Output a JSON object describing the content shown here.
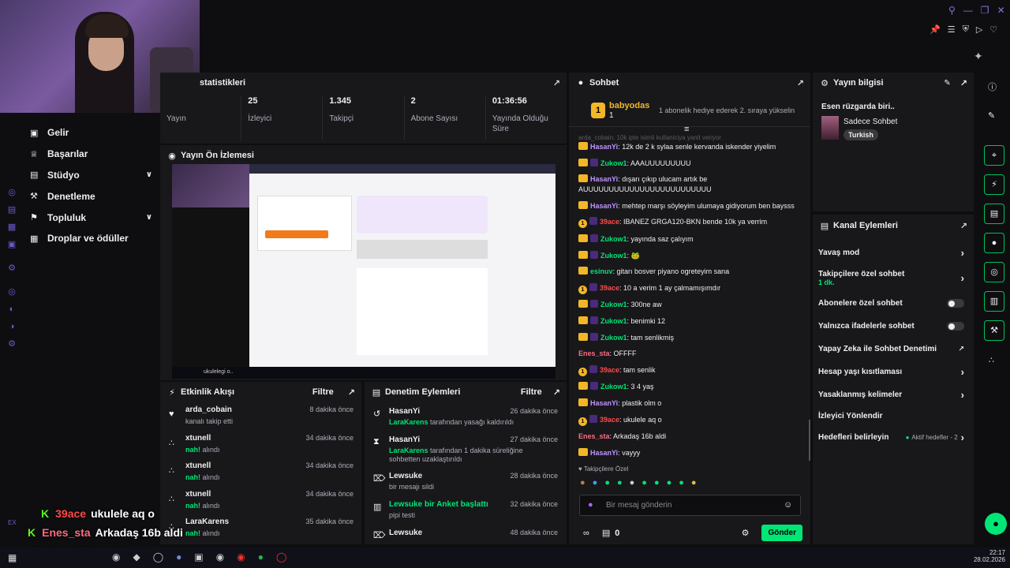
{
  "topbar": {
    "icons": [
      "search-icon",
      "minimize-icon",
      "maximize-icon",
      "close-icon"
    ],
    "toolbar_icons": [
      "pin-icon",
      "list-icon",
      "shield-icon",
      "play-icon",
      "heart-icon"
    ]
  },
  "sidebar": {
    "items": [
      {
        "label": "Gelir",
        "icon": "money-icon",
        "expand": false
      },
      {
        "label": "Başarılar",
        "icon": "trophy-icon",
        "expand": false
      },
      {
        "label": "Stüdyo",
        "icon": "studio-icon",
        "expand": true
      },
      {
        "label": "Denetleme",
        "icon": "hammer-icon",
        "expand": false
      },
      {
        "label": "Topluluk",
        "icon": "community-icon",
        "expand": true
      },
      {
        "label": "Droplar ve ödüller",
        "icon": "drops-icon",
        "expand": false
      }
    ]
  },
  "stats": {
    "title": "statistikleri",
    "items": [
      {
        "value": "",
        "label": "Yayın"
      },
      {
        "value": "25",
        "label": "İzleyici"
      },
      {
        "value": "1.345",
        "label": "Takipçi"
      },
      {
        "value": "2",
        "label": "Abone Sayısı"
      },
      {
        "value": "01:36:56",
        "label": "Yayında Olduğu Süre"
      }
    ]
  },
  "preview": {
    "title": "Yayın Ön İzlemesi",
    "taskbar_text": "ukulelegi o.."
  },
  "activity": {
    "title": "Etkinlik Akışı",
    "filter": "Filtre",
    "items": [
      {
        "user": "arda_cobain",
        "time": "8 dakika önce",
        "pre": "",
        "hl": "",
        "post": "kanalı takip etti"
      },
      {
        "user": "xtunell",
        "time": "34 dakika önce",
        "pre": "",
        "hl": "nah!",
        "post": " alındı"
      },
      {
        "user": "xtunell",
        "time": "34 dakika önce",
        "pre": "",
        "hl": "nah!",
        "post": " alındı"
      },
      {
        "user": "xtunell",
        "time": "34 dakika önce",
        "pre": "",
        "hl": "nah!",
        "post": " alındı"
      },
      {
        "user": "LaraKarens",
        "time": "35 dakika önce",
        "pre": "",
        "hl": "nah!",
        "post": " alındı"
      }
    ]
  },
  "modactions": {
    "title": "Denetim Eylemleri",
    "filter": "Filtre",
    "items": [
      {
        "user": "HasanYi",
        "time": "26 dakika önce",
        "hl": "LaraKarens",
        "text": " tarafından yasağı kaldırıldı"
      },
      {
        "user": "HasanYi",
        "time": "27 dakika önce",
        "hl": "LaraKarens",
        "text": " tarafından 1 dakika süreliğine sohbetten uzaklaştırıldı"
      },
      {
        "user": "Lewsuke",
        "time": "28 dakika önce",
        "hl": "",
        "text": "bir mesajı sildi"
      },
      {
        "user": "Lewsuke bir Anket başlattı",
        "time": "32 dakika önce",
        "hl": "",
        "text": "pipi testi"
      },
      {
        "user": "Lewsuke",
        "time": "48 dakika önce",
        "hl": "",
        "text": ""
      }
    ]
  },
  "chat": {
    "title": "Sohbet",
    "pinned_user": "babyodas",
    "pinned_count": "1",
    "pinned_msg": "1 abonelik hediye ederek 2. sıraya yükselin",
    "faded": "arda_cobain: 10k ipte isimli kullaniciya yanit veriyor",
    "messages": [
      {
        "badge": "crown",
        "gift": false,
        "user": "HasanYi",
        "color": "#bf94ff",
        "text": "12k de 2 k sylaa senle kervanda iskender yiyelim"
      },
      {
        "badge": "crown",
        "gift": true,
        "user": "Zukow1",
        "color": "#00e676",
        "text": "AAAUUUUUUUUU"
      },
      {
        "badge": "crown",
        "gift": false,
        "user": "HasanYi",
        "color": "#bf94ff",
        "text": "dışarı çıkıp ulucam artık be AUUUUUUUUUUUUUUUUUUUUUUUUU"
      },
      {
        "badge": "crown",
        "gift": false,
        "user": "HasanYi",
        "color": "#bf94ff",
        "text": "mehtep marşı söyleyim ulumaya gidiyorum ben baysss"
      },
      {
        "badge": "sub",
        "gift": true,
        "user": "39ace",
        "color": "#ff4a4a",
        "text": "IBANEZ GRGA120-BKN bende 10k ya verrim"
      },
      {
        "badge": "crown",
        "gift": true,
        "user": "Zukow1",
        "color": "#00e676",
        "text": "yayında saz çalıyım"
      },
      {
        "badge": "crown",
        "gift": true,
        "user": "Zukow1",
        "color": "#00e676",
        "text": "🐸"
      },
      {
        "badge": "crown",
        "gift": false,
        "user": "esinuv",
        "color": "#00e676",
        "text": "gitarı bosver piyano ogreteyim sana"
      },
      {
        "badge": "sub",
        "gift": true,
        "user": "39ace",
        "color": "#ff4a4a",
        "text": "10 a verim 1 ay çalmamışımdır"
      },
      {
        "badge": "crown",
        "gift": true,
        "user": "Zukow1",
        "color": "#00e676",
        "text": "300ne aw"
      },
      {
        "badge": "crown",
        "gift": true,
        "user": "Zukow1",
        "color": "#00e676",
        "text": "benimki 12"
      },
      {
        "badge": "crown",
        "gift": true,
        "user": "Zukow1",
        "color": "#00e676",
        "text": "tam senlikmiş"
      },
      {
        "badge": "",
        "gift": false,
        "user": "Enes_sta",
        "color": "#ff6b81",
        "text": "OFFFF"
      },
      {
        "badge": "sub",
        "gift": true,
        "user": "39ace",
        "color": "#ff4a4a",
        "text": "tam senlik"
      },
      {
        "badge": "crown",
        "gift": true,
        "user": "Zukow1",
        "color": "#00e676",
        "text": "3 4 yaş"
      },
      {
        "badge": "crown",
        "gift": false,
        "user": "HasanYi",
        "color": "#bf94ff",
        "text": "plastik olm o"
      },
      {
        "badge": "sub",
        "gift": true,
        "user": "39ace",
        "color": "#ff4a4a",
        "text": "ukulele aq o"
      },
      {
        "badge": "",
        "gift": false,
        "user": "Enes_sta",
        "color": "#ff6b81",
        "text": "Arkadaş 16b aldi"
      },
      {
        "badge": "crown",
        "gift": false,
        "user": "HasanYi",
        "color": "#bf94ff",
        "text": "vayyy"
      }
    ],
    "followers_only": "Takipçilere Özel",
    "input_placeholder": "Bir mesaj gönderin",
    "points": "0",
    "send": "Gönder"
  },
  "info": {
    "title": "Yayın bilgisi",
    "stream_title": "Esen rüzgarda biri..",
    "category": "Sadece Sohbet",
    "tag": "Turkish"
  },
  "channel": {
    "title": "Kanal Eylemleri",
    "items": [
      {
        "label": "Yavaş mod",
        "sub": "",
        "control": "chevron"
      },
      {
        "label": "Takipçilere özel sohbet",
        "sub": "1 dk.",
        "control": "chevron"
      },
      {
        "label": "Abonelere özel sohbet",
        "sub": "",
        "control": "toggle"
      },
      {
        "label": "Yalnızca ifadelerle sohbet",
        "sub": "",
        "control": "toggle"
      },
      {
        "label": "Yapay Zeka ile Sohbet Denetimi",
        "sub": "",
        "control": "external"
      },
      {
        "label": "Hesap yaşı kısıtlaması",
        "sub": "",
        "control": "chevron"
      },
      {
        "label": "Yasaklanmış kelimeler",
        "sub": "",
        "control": "chevron"
      },
      {
        "label": "İzleyici Yönlendir",
        "sub": "",
        "control": "none"
      },
      {
        "label": "Hedefleri belirleyin",
        "sub": "",
        "control": "goals",
        "extra": "Aktif hedefler - 2"
      }
    ]
  },
  "overlay": [
    {
      "user": "39ace",
      "color": "#ff4a4a",
      "text": "ukulele aq o"
    },
    {
      "user": "Enes_sta",
      "color": "#ff6b81",
      "text": "Arkadaş 16b aldi"
    },
    {
      "user": "HasanYi",
      "color": "#bf94ff",
      "text": "vayyy"
    }
  ],
  "taskbar": {
    "time": "22:17",
    "date": "28.02.2026"
  }
}
